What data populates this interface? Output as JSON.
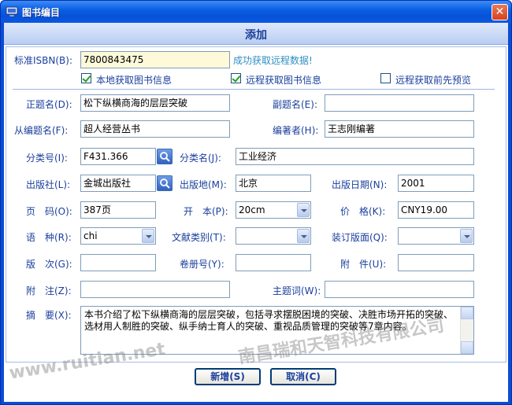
{
  "window": {
    "title": "图书编目",
    "close_glyph": "✕"
  },
  "header": {
    "title": "添加"
  },
  "isbn": {
    "label": "标准ISBN(B):",
    "value": "7800843475"
  },
  "remote_status": "成功获取远程数据!",
  "checkboxes": [
    {
      "label": "本地获取图书信息",
      "checked": true
    },
    {
      "label": "远程获取图书信息",
      "checked": true
    },
    {
      "label": "远程获取前先预览",
      "checked": false
    }
  ],
  "fields": {
    "title": {
      "label": "正题名(D):",
      "value": "松下纵横商海的层层突破"
    },
    "subtitle": {
      "label": "副题名(E):",
      "value": ""
    },
    "series": {
      "label": "从编题名(F):",
      "value": "超人经营丛书"
    },
    "author": {
      "label": "编著者(H):",
      "value": "王志刚编著"
    },
    "class_no": {
      "label": "分类号(I):",
      "value": "F431.366"
    },
    "class_name": {
      "label": "分类名(J):",
      "value": "工业经济"
    },
    "publisher": {
      "label": "出版社(L):",
      "value": "金城出版社"
    },
    "pub_place": {
      "label": "出版地(M):",
      "value": "北京"
    },
    "pub_date": {
      "label": "出版日期(N):",
      "value": "2001"
    },
    "pages": {
      "label": "页　码(O):",
      "value": "387页"
    },
    "size": {
      "label": "开　本(P):",
      "value": "20cm"
    },
    "price": {
      "label": "价　格(K):",
      "value": "CNY19.00"
    },
    "language": {
      "label": "语　种(R):",
      "value": "chi"
    },
    "doc_type": {
      "label": "文献类别(T):",
      "value": ""
    },
    "binding": {
      "label": "装订版面(Q):",
      "value": ""
    },
    "edition": {
      "label": "版　次(G):",
      "value": ""
    },
    "volume": {
      "label": "卷册号(Y):",
      "value": ""
    },
    "attachment": {
      "label": "附　件(U):",
      "value": ""
    },
    "note": {
      "label": "附　注(Z):",
      "value": ""
    },
    "subject": {
      "label": "主题词(W):",
      "value": ""
    },
    "abstract": {
      "label": "摘　要(X):",
      "value": "本书介绍了松下纵横商海的层层突破，包括寻求摆脱困境的突破、决胜市场开拓的突破、选材用人制胜的突破、纵手纳士育人的突破、重视品质管理的突破等7章内容。"
    }
  },
  "buttons": {
    "add": "新增(S)",
    "cancel": "取消(C)"
  },
  "watermark": {
    "company": "南昌瑞和天智科技有限公司",
    "site": "www.ruitian.net"
  }
}
